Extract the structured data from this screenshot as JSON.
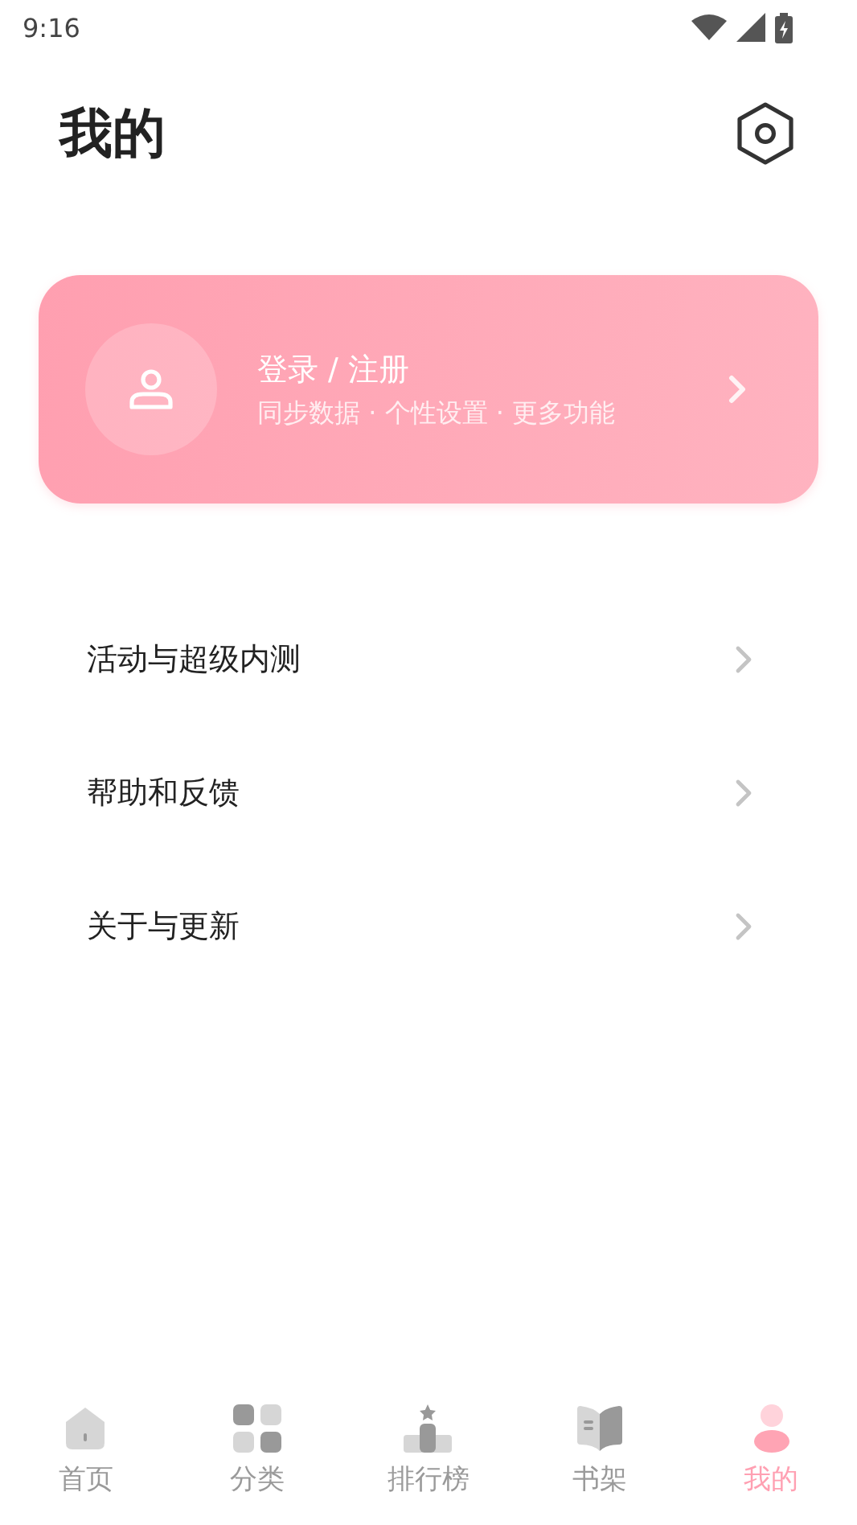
{
  "status_bar": {
    "time": "9:16"
  },
  "header": {
    "title": "我的"
  },
  "login_card": {
    "title": "登录 / 注册",
    "subtitle": "同步数据 · 个性设置 · 更多功能"
  },
  "menu": [
    {
      "label": "活动与超级内测"
    },
    {
      "label": "帮助和反馈"
    },
    {
      "label": "关于与更新"
    }
  ],
  "bottom_nav": [
    {
      "kind": "home",
      "label": "首页",
      "selected": false
    },
    {
      "kind": "category",
      "label": "分类",
      "selected": false
    },
    {
      "kind": "ranking",
      "label": "排行榜",
      "selected": false
    },
    {
      "kind": "shelf",
      "label": "书架",
      "selected": false
    },
    {
      "kind": "profile",
      "label": "我的",
      "selected": true
    }
  ]
}
